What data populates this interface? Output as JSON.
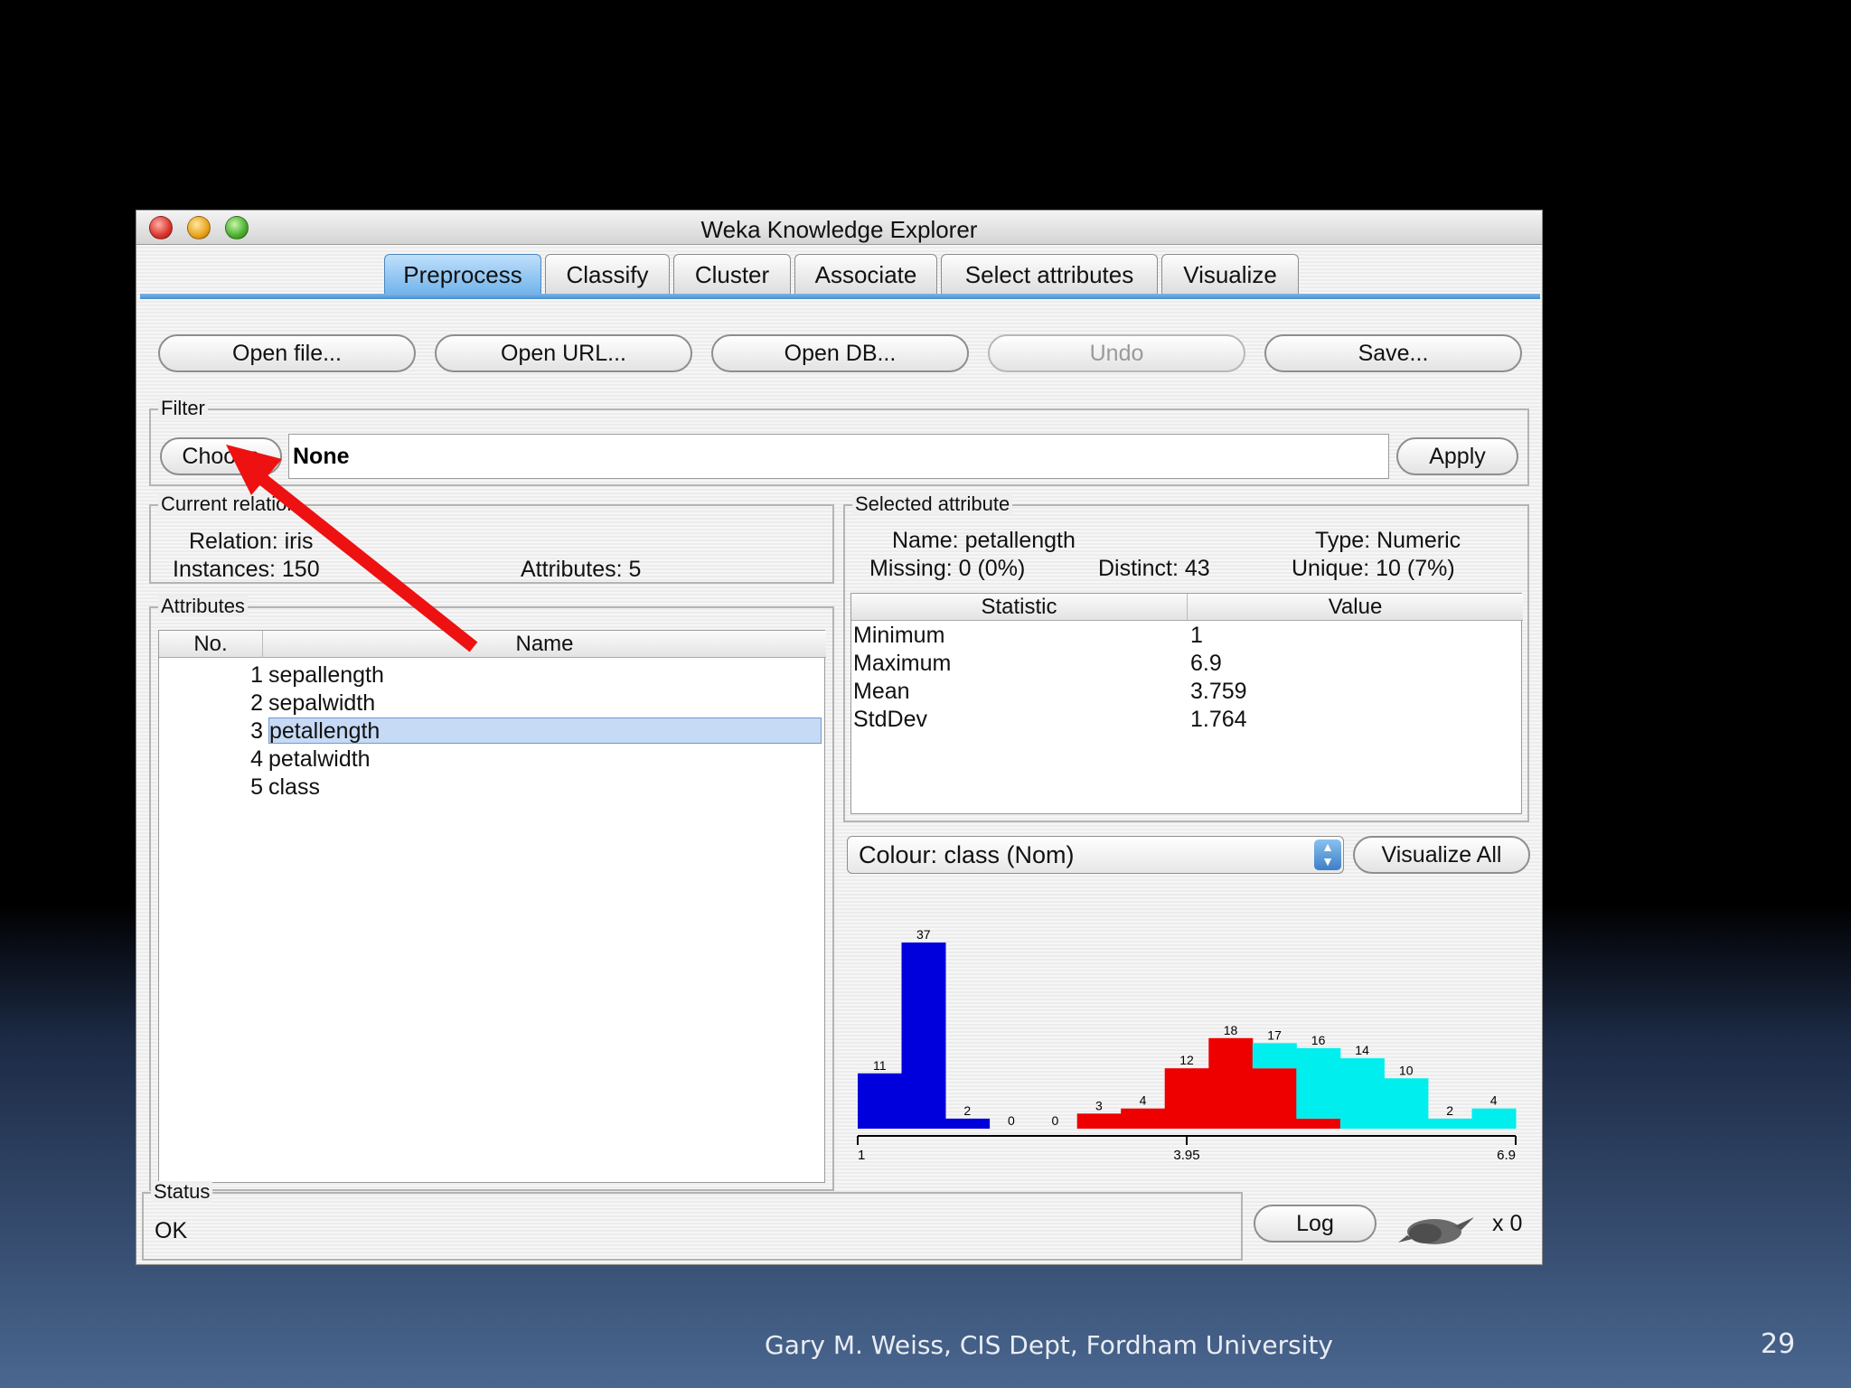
{
  "window": {
    "title": "Weka Knowledge Explorer"
  },
  "tabs": [
    "Preprocess",
    "Classify",
    "Cluster",
    "Associate",
    "Select attributes",
    "Visualize"
  ],
  "toolbar": {
    "open_file": "Open file...",
    "open_url": "Open URL...",
    "open_db": "Open DB...",
    "undo": "Undo",
    "save": "Save..."
  },
  "filter": {
    "group_label": "Filter",
    "choose_label": "Choose",
    "value": "None",
    "apply_label": "Apply"
  },
  "current_relation": {
    "group_label": "Current relation",
    "relation": "Relation: iris",
    "instances": "Instances: 150",
    "attributes": "Attributes: 5"
  },
  "attributes": {
    "group_label": "Attributes",
    "col_no": "No.",
    "col_name": "Name",
    "rows": [
      {
        "no": "1",
        "name": "sepallength"
      },
      {
        "no": "2",
        "name": "sepalwidth"
      },
      {
        "no": "3",
        "name": "petallength"
      },
      {
        "no": "4",
        "name": "petalwidth"
      },
      {
        "no": "5",
        "name": "class"
      }
    ],
    "selected_index": 2
  },
  "selected_attribute": {
    "group_label": "Selected attribute",
    "name": "Name: petallength",
    "type": "Type: Numeric",
    "missing": "Missing: 0 (0%)",
    "distinct": "Distinct: 43",
    "unique": "Unique: 10 (7%)",
    "col_statistic": "Statistic",
    "col_value": "Value",
    "stats": [
      {
        "statistic": "Minimum",
        "value": "1"
      },
      {
        "statistic": "Maximum",
        "value": "6.9"
      },
      {
        "statistic": "Mean",
        "value": "3.759"
      },
      {
        "statistic": "StdDev",
        "value": "1.764"
      }
    ]
  },
  "colour_select": {
    "value": "Colour: class (Nom)"
  },
  "visualize_all_label": "Visualize All",
  "status": {
    "group_label": "Status",
    "text": "OK",
    "log_label": "Log",
    "count": "x 0"
  },
  "slide": {
    "footer": "Gary M. Weiss, CIS Dept, Fordham University",
    "page": "29"
  },
  "colors": {
    "blue": "#0000dd",
    "red": "#ee0000",
    "cyan": "#00eeee",
    "arrow": "#ee1111",
    "selection": "#c6daf5"
  },
  "chart_data": {
    "type": "bar",
    "stacked": true,
    "bins": 17,
    "xmin": 1,
    "xmax": 6.9,
    "tick_labels": [
      "1",
      "3.95",
      "6.9"
    ],
    "totals": [
      11,
      37,
      2,
      0,
      0,
      3,
      4,
      12,
      18,
      17,
      16,
      14,
      10,
      2,
      4
    ],
    "series": [
      {
        "color": "#0000dd",
        "values": [
          11,
          37,
          2,
          0,
          0,
          0,
          0,
          0,
          0,
          0,
          0,
          0,
          0,
          0,
          0
        ]
      },
      {
        "color": "#ee0000",
        "values": [
          0,
          0,
          0,
          0,
          0,
          3,
          4,
          12,
          18,
          12,
          2,
          0,
          0,
          0,
          0
        ]
      },
      {
        "color": "#00eeee",
        "values": [
          0,
          0,
          0,
          0,
          0,
          0,
          0,
          0,
          0,
          5,
          14,
          14,
          10,
          2,
          4
        ]
      }
    ],
    "ylim": [
      0,
      37
    ]
  }
}
